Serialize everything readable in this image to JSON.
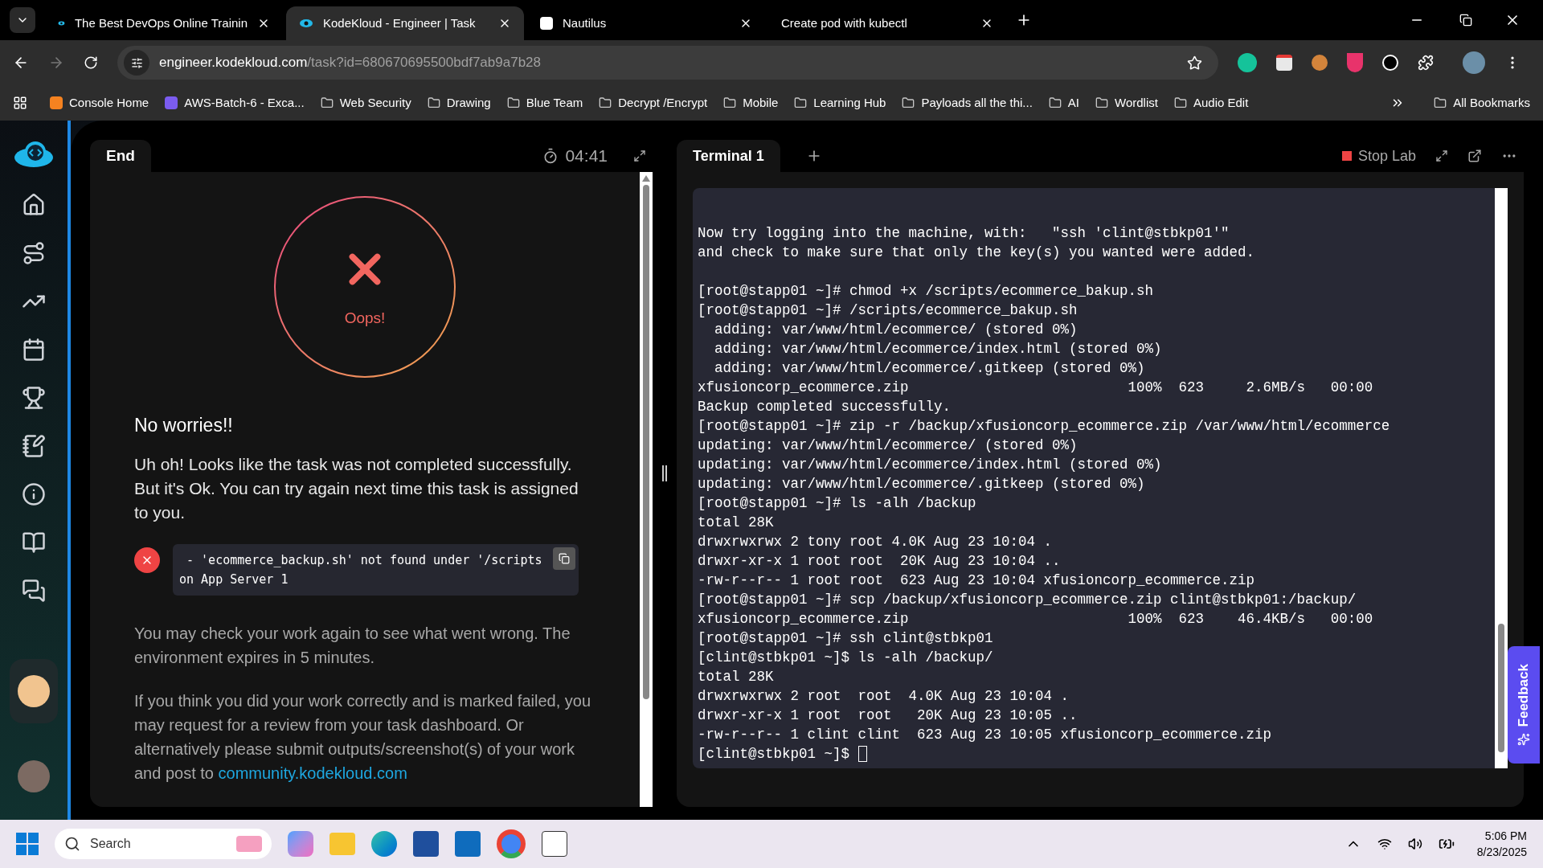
{
  "browser": {
    "tabs": [
      {
        "title": "The Best DevOps Online Trainin",
        "selected": false
      },
      {
        "title": "KodeKloud - Engineer | Task",
        "selected": true
      },
      {
        "title": "Nautilus",
        "selected": false
      },
      {
        "title": "Create pod with kubectl",
        "selected": false
      }
    ],
    "address": {
      "host": "engineer.kodekloud.com",
      "path": "/task?id=680670695500bdf7ab9a7b28"
    },
    "bookmarks": [
      {
        "label": "Console Home",
        "kind": "orange"
      },
      {
        "label": "AWS-Batch-6 - Exca...",
        "kind": "purple"
      },
      {
        "label": "Web Security",
        "kind": "folder"
      },
      {
        "label": "Drawing",
        "kind": "folder"
      },
      {
        "label": "Blue Team",
        "kind": "folder"
      },
      {
        "label": "Decrypt /Encrypt",
        "kind": "folder"
      },
      {
        "label": "Mobile",
        "kind": "folder"
      },
      {
        "label": "Learning Hub",
        "kind": "folder"
      },
      {
        "label": "Payloads all the thi...",
        "kind": "folder"
      },
      {
        "label": "AI",
        "kind": "folder"
      },
      {
        "label": "Wordlist",
        "kind": "folder"
      },
      {
        "label": "Audio Edit",
        "kind": "folder"
      }
    ],
    "all_bookmarks": "All Bookmarks"
  },
  "task_panel": {
    "tab": "End",
    "timer": "04:41",
    "status": "Oops!",
    "heading": "No worries!!",
    "message": "Uh oh! Looks like the task was not completed successfully. But it's Ok. You can try again next time this task is assigned to you.",
    "error_lines": [
      " - 'ecommerce_backup.sh' not found under '/scripts",
      "on App Server 1"
    ],
    "note": "You may check your work again to see what went wrong. The environment expires in 5 minutes.",
    "review": "If you think you did your work correctly and is marked failed, you may request for a review from your task dashboard. Or alternatively please submit outputs/screenshot(s) of your work and post to ",
    "link": "community.kodekloud.com"
  },
  "terminal": {
    "tabs": [
      {
        "label": "Terminal 1",
        "selected": true
      }
    ],
    "stop": "Stop Lab",
    "blocks": [
      [
        "Now try logging into the machine, with:   \"ssh 'clint@stbkp01'\"",
        "and check to make sure that only the key(s) you wanted were added."
      ],
      [
        "[root@stapp01 ~]# chmod +x /scripts/ecommerce_bakup.sh",
        "[root@stapp01 ~]# /scripts/ecommerce_bakup.sh",
        "  adding: var/www/html/ecommerce/ (stored 0%)",
        "  adding: var/www/html/ecommerce/index.html (stored 0%)",
        "  adding: var/www/html/ecommerce/.gitkeep (stored 0%)",
        "xfusioncorp_ecommerce.zip                          100%  623     2.6MB/s   00:00",
        "Backup completed successfully.",
        "[root@stapp01 ~]# zip -r /backup/xfusioncorp_ecommerce.zip /var/www/html/ecommerce",
        "updating: var/www/html/ecommerce/ (stored 0%)",
        "updating: var/www/html/ecommerce/index.html (stored 0%)",
        "updating: var/www/html/ecommerce/.gitkeep (stored 0%)",
        "[root@stapp01 ~]# ls -alh /backup",
        "total 28K",
        "drwxrwxrwx 2 tony root 4.0K Aug 23 10:04 .",
        "drwxr-xr-x 1 root root  20K Aug 23 10:04 ..",
        "-rw-r--r-- 1 root root  623 Aug 23 10:04 xfusioncorp_ecommerce.zip",
        "[root@stapp01 ~]# scp /backup/xfusioncorp_ecommerce.zip clint@stbkp01:/backup/",
        "xfusioncorp_ecommerce.zip                          100%  623    46.4KB/s   00:00",
        "[root@stapp01 ~]# ssh clint@stbkp01",
        "[clint@stbkp01 ~]$ ls -alh /backup/",
        "total 28K",
        "drwxrwxrwx 2 root  root  4.0K Aug 23 10:04 .",
        "drwxr-xr-x 1 root  root   20K Aug 23 10:05 ..",
        "-rw-r--r-- 1 clint clint  623 Aug 23 10:05 xfusioncorp_ecommerce.zip"
      ]
    ],
    "prompt": "[clint@stbkp01 ~]$ "
  },
  "feedback": "Feedback",
  "taskbar": {
    "search": "Search",
    "time": "5:06 PM",
    "date": "8/23/2025"
  }
}
